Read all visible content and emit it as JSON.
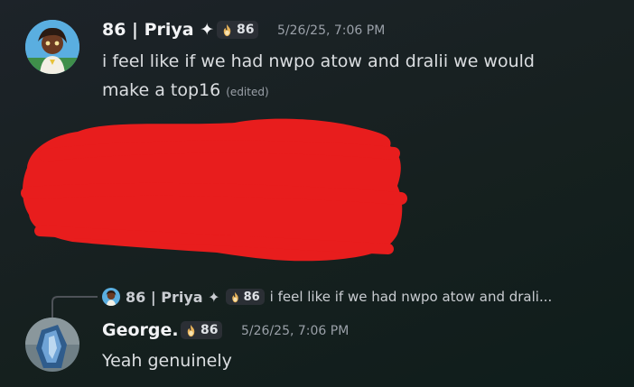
{
  "messages": [
    {
      "author": "86 | Priya ✦",
      "tag": "86",
      "timestamp": "5/26/25, 7:06 PM",
      "lines": [
        "i feel like if we had nwpo atow and dralii we would",
        "make a top16"
      ],
      "edited_label": "(edited)"
    },
    {
      "author": "George.",
      "tag": "86",
      "timestamp": "5/26/25, 7:06 PM",
      "text": "Yeah genuinely",
      "reply": {
        "author": "86 | Priya ✦",
        "tag": "86",
        "preview": "i feel like if we had nwpo atow and drali..."
      }
    }
  ],
  "icons": [
    "avatar-priya",
    "avatar-george",
    "clan-flame-icon"
  ],
  "colors": {
    "redaction": "#e81d1d",
    "tag_bg": "#2b2f35",
    "muted": "#9aa0a8"
  }
}
